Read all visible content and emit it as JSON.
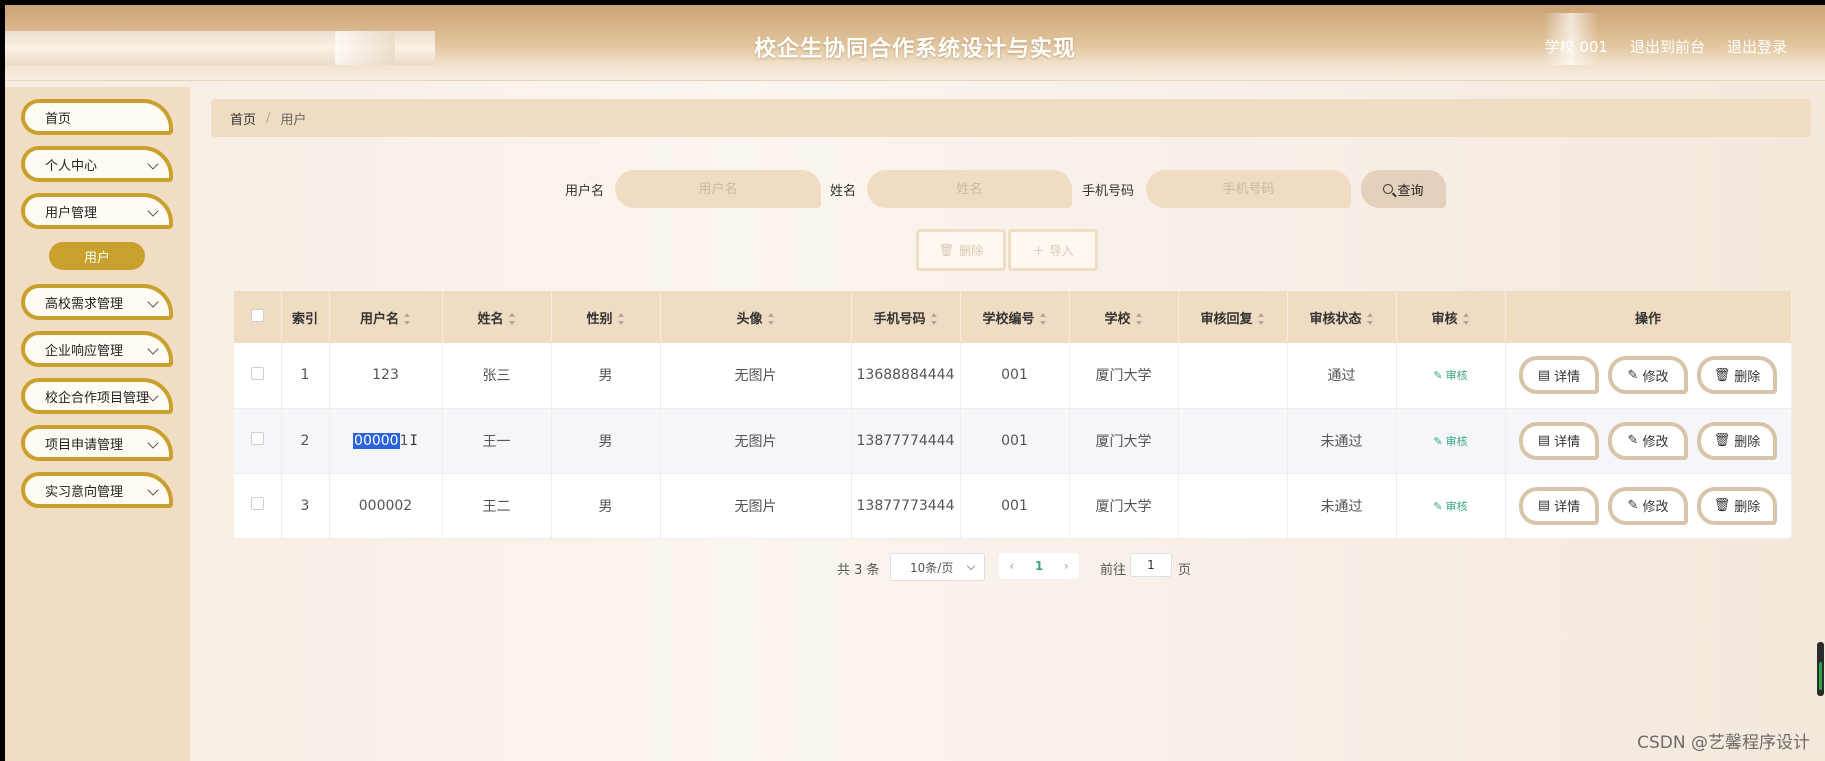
{
  "header": {
    "title": "校企生协同合作系统设计与实现",
    "nav": [
      "学校 001",
      "退出到前台",
      "退出登录"
    ]
  },
  "sidebar": {
    "items": [
      {
        "label": "首页",
        "expandable": false
      },
      {
        "label": "个人中心",
        "expandable": true
      },
      {
        "label": "用户管理",
        "expandable": true
      },
      {
        "label": "高校需求管理",
        "expandable": true
      },
      {
        "label": "企业响应管理",
        "expandable": true
      },
      {
        "label": "校企合作项目管理",
        "expandable": true
      },
      {
        "label": "项目申请管理",
        "expandable": true
      },
      {
        "label": "实习意向管理",
        "expandable": true
      }
    ],
    "submenu_active": "用户"
  },
  "breadcrumb": {
    "home": "首页",
    "sep": "/",
    "current": "用户"
  },
  "search": {
    "username_label": "用户名",
    "username_placeholder": "用户名",
    "name_label": "姓名",
    "name_placeholder": "姓名",
    "phone_label": "手机号码",
    "phone_placeholder": "手机号码",
    "query_label": "查询"
  },
  "actions": {
    "delete_label": "删除",
    "import_label": "导入"
  },
  "table": {
    "headers": [
      "索引",
      "用户名",
      "姓名",
      "性别",
      "头像",
      "手机号码",
      "学校编号",
      "学校",
      "审核回复",
      "审核状态",
      "审核",
      "操作"
    ],
    "rows": [
      {
        "index": "1",
        "username": "123",
        "name": "张三",
        "gender": "男",
        "avatar": "无图片",
        "phone": "13688884444",
        "school_no": "001",
        "school": "厦门大学",
        "reply": "",
        "status": "通过"
      },
      {
        "index": "2",
        "username": "000001",
        "name": "王一",
        "gender": "男",
        "avatar": "无图片",
        "phone": "13877774444",
        "school_no": "001",
        "school": "厦门大学",
        "reply": "",
        "status": "未通过"
      },
      {
        "index": "3",
        "username": "000002",
        "name": "王二",
        "gender": "男",
        "avatar": "无图片",
        "phone": "13877773444",
        "school_no": "001",
        "school": "厦门大学",
        "reply": "",
        "status": "未通过"
      }
    ],
    "audit_label": "审核",
    "op_detail": "详情",
    "op_edit": "修改",
    "op_delete": "删除",
    "selection_text": "00000",
    "selection_tail": "1"
  },
  "pagination": {
    "total": "共 3 条",
    "page_size": "10条/页",
    "current_page": "1",
    "goto_label": "前往",
    "goto_value": "1",
    "page_unit": "页"
  },
  "watermark": "CSDN @艺馨程序设计"
}
